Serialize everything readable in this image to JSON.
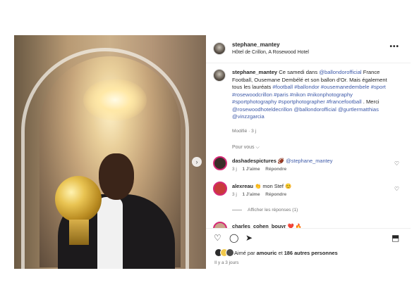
{
  "post": {
    "username": "stephane_mantey",
    "location": "Hôtel de Crillon, A Rosewood Hotel",
    "more_icon": "•••"
  },
  "caption": {
    "username": "stephane_mantey",
    "text_1": "Ce samedi dans ",
    "mention_1": "@ballondorofficial",
    "text_2": " France Football, Ousemane Dembélé et son ballon d'Or. Mais également tous les lauréats ",
    "hashtags": "#football #ballondor #ousemanedembele #sport #rosewoodcrillon #paris #nikon #nikonphotography #sportphotography #sportphotographer #francefootball",
    "text_3": " . Merci ",
    "mention_2": "@rosewoodhoteldecrillon @ballondorofficial @gurtlermatthias @vinzzgarcia",
    "edited": "Modifié · 3 j"
  },
  "pour_vous": "Pour vous ⌵",
  "comments": [
    {
      "username": "dashadespictures",
      "emoji": "🏈",
      "mention": "@stephane_mantey",
      "age": "3 j",
      "likes": "1 J'aime",
      "reply": "Répondre",
      "avatar_color": "#3a2d28"
    },
    {
      "username": "alexreau",
      "emoji": "👏",
      "text": "mon Stef 😊",
      "age": "3 j",
      "likes": "1 J'aime",
      "reply": "Répondre",
      "avatar_color": "#c83b3b"
    }
  ],
  "view_replies": "Afficher les réponses (1)",
  "cut_comment": {
    "username": "charles_cohen_bouvr",
    "emoji": "❤️ 🔥"
  },
  "actions": {
    "like_icon": "♡",
    "comment_icon": "◯",
    "share_icon": "➤",
    "save_icon": "⬒"
  },
  "likes": {
    "prefix": "Aimé par ",
    "user": "amouric",
    "suffix": " et ",
    "others": "186 autres personnes"
  },
  "time_ago": "Il y a 3 jours",
  "icons": {
    "heart": "♡",
    "next": "›"
  }
}
